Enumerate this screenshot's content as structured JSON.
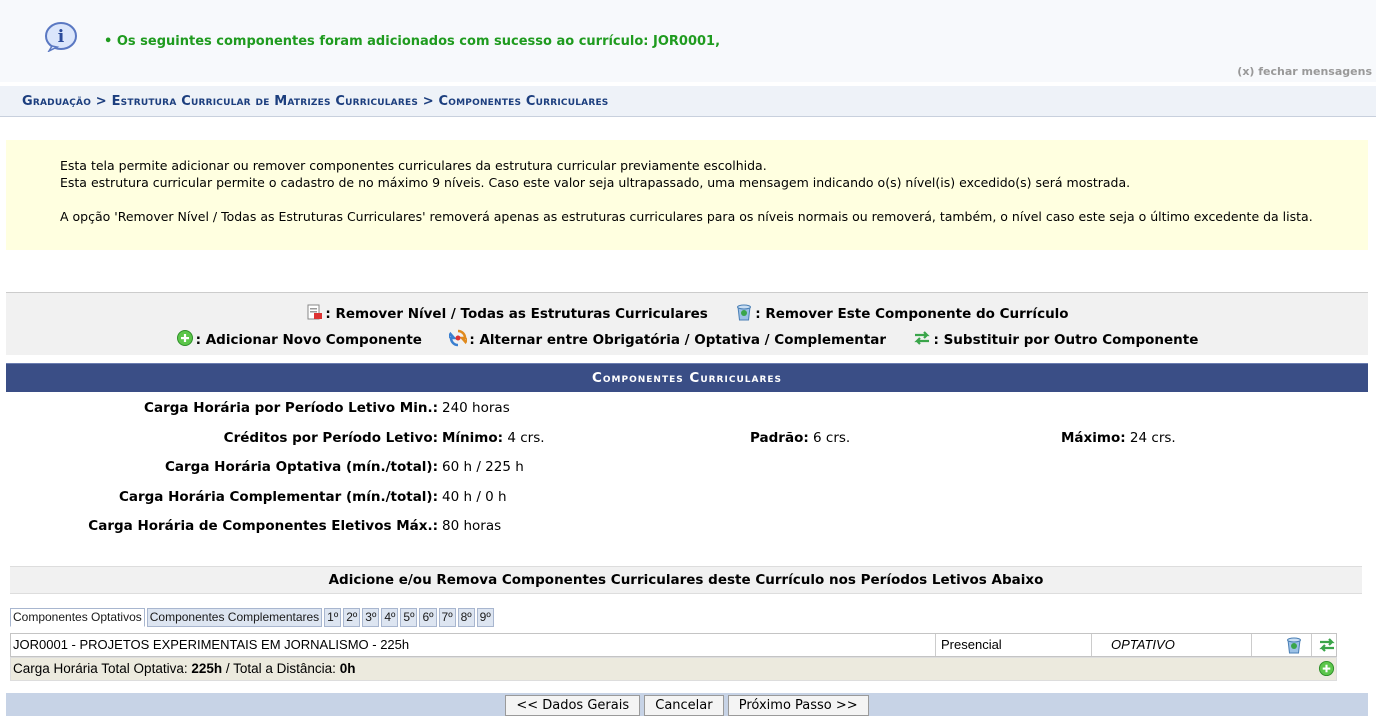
{
  "messages": {
    "success": "• Os seguintes componentes foram adicionados com sucesso ao currículo: JOR0001,",
    "close": "(x) fechar mensagens"
  },
  "breadcrumb": "Graduação > Estrutura Curricular de Matrizes Curriculares > Componentes Curriculares",
  "help": {
    "p1": "Esta tela permite adicionar ou remover componentes curriculares da estrutura curricular previamente escolhida.",
    "p2": "Esta estrutura curricular permite o cadastro de no máximo 9 níveis. Caso este valor seja ultrapassado, uma mensagem indicando o(s) nível(is) excedido(s) será mostrada.",
    "p3": "A opção 'Remover Nível / Todas as Estruturas Curriculares' removerá apenas as estruturas curriculares para os níveis normais ou removerá, também, o nível caso este seja o último excedente da lista."
  },
  "legend": {
    "remove_level": ": Remover Nível / Todas as Estruturas Curriculares",
    "remove_component": ": Remover Este Componente do Currículo",
    "add": ": Adicionar Novo Componente",
    "toggle": ": Alternar entre Obrigatória / Optativa / Complementar",
    "replace": ": Substituir por Outro Componente"
  },
  "panel": {
    "title": "Componentes Curriculares",
    "ch_min_label": "Carga Horária por Período Letivo Min.:",
    "ch_min_value": "240 horas",
    "creditos_label": "Créditos por Período Letivo:",
    "minimo_label": "Mínimo:",
    "minimo_value": "4 crs.",
    "padrao_label": "Padrão:",
    "padrao_value": "6 crs.",
    "maximo_label": "Máximo:",
    "maximo_value": "24 crs.",
    "ch_opt_label": "Carga Horária Optativa (mín./total):",
    "ch_opt_value": "60 h / 225 h",
    "ch_comp_label": "Carga Horária Complementar (mín./total):",
    "ch_comp_value": "40 h / 0 h",
    "ch_elet_label": "Carga Horária de Componentes Eletivos Máx.:",
    "ch_elet_value": "80 horas",
    "subhead": "Adicione e/ou Remova Componentes Curriculares deste Currículo nos Períodos Letivos Abaixo"
  },
  "tabs": [
    "Componentes Optativos",
    "Componentes Complementares",
    "1º",
    "2º",
    "3º",
    "4º",
    "5º",
    "6º",
    "7º",
    "8º",
    "9º"
  ],
  "component_row": {
    "name": "JOR0001 - PROJETOS EXPERIMENTAIS EM JORNALISMO - 225h",
    "modality": "Presencial",
    "type": "OPTATIVO"
  },
  "total_row": {
    "prefix": "Carga Horária Total Optativa: ",
    "total": "225h",
    "mid": " / Total a Distância: ",
    "distance": "0h"
  },
  "buttons": {
    "back": "<< Dados Gerais",
    "cancel": "Cancelar",
    "next": "Próximo Passo >>"
  }
}
